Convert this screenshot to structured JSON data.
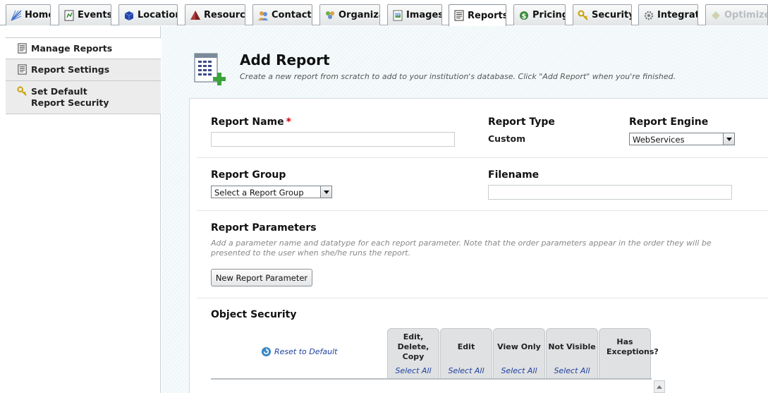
{
  "tabs": [
    {
      "label": "Home",
      "icon": "home-icon"
    },
    {
      "label": "Events",
      "icon": "events-icon"
    },
    {
      "label": "Locations",
      "icon": "locations-icon"
    },
    {
      "label": "Resources",
      "icon": "resources-icon"
    },
    {
      "label": "Contacts",
      "icon": "contacts-icon"
    },
    {
      "label": "Organizations",
      "icon": "organizations-icon"
    },
    {
      "label": "Images",
      "icon": "images-icon"
    },
    {
      "label": "Reports",
      "icon": "reports-icon",
      "active": true
    },
    {
      "label": "Pricing",
      "icon": "pricing-icon"
    },
    {
      "label": "Security",
      "icon": "security-icon"
    },
    {
      "label": "Integrations",
      "icon": "integrations-icon"
    },
    {
      "label": "Optimizer",
      "icon": "optimizer-icon",
      "disabled": true
    }
  ],
  "sidebar": {
    "items": [
      {
        "label": "Manage Reports",
        "icon": "report-icon",
        "active": true
      },
      {
        "label": "Report Settings",
        "icon": "report-icon"
      },
      {
        "label": "Set Default Report Security",
        "icon": "key-icon"
      }
    ]
  },
  "header": {
    "title": "Add Report",
    "subtitle": "Create a new report from scratch to add to your institution's database. Click \"Add Report\" when you're finished."
  },
  "form": {
    "report_name_label": "Report Name",
    "required_mark": "*",
    "report_name_value": "",
    "report_type_label": "Report Type",
    "report_type_value": "Custom",
    "report_engine_label": "Report Engine",
    "report_engine_value": "WebServices",
    "report_group_label": "Report Group",
    "report_group_value": "Select a Report Group",
    "filename_label": "Filename",
    "filename_value": "",
    "params_label": "Report Parameters",
    "params_help": "Add a parameter name and datatype for each report parameter. Note that the order parameters appear in the order they will be presented to the user when she/he runs the report.",
    "new_param_button": "New Report Parameter",
    "object_security_label": "Object Security",
    "reset_label": "Reset to Default",
    "permission_columns": [
      {
        "header": "Edit, Delete, Copy",
        "select_all": "Select All"
      },
      {
        "header": "Edit",
        "select_all": "Select All"
      },
      {
        "header": "View Only",
        "select_all": "Select All"
      },
      {
        "header": "Not Visible",
        "select_all": "Select All"
      },
      {
        "header": "Has Exceptions?",
        "select_all": ""
      }
    ]
  },
  "colors": {
    "accent": "#2040a0",
    "required": "#cc0000",
    "tab_border": "#9aa3aa"
  }
}
